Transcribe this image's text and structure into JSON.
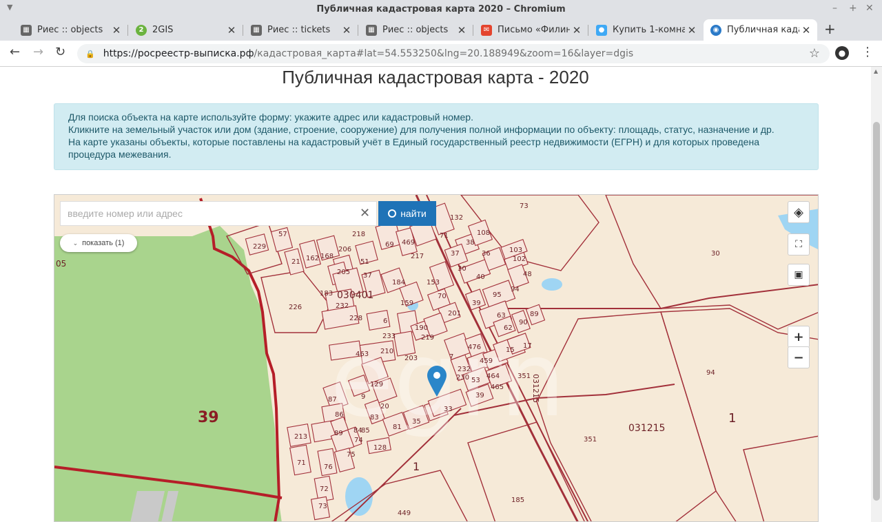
{
  "window": {
    "title": "Публичная кадастровая карта 2020 – Chromium"
  },
  "tabs": [
    {
      "label": "Риес :: objects",
      "icon": "riesgrid-icon",
      "color": "#555"
    },
    {
      "label": "2GIS",
      "icon": "2gis-icon",
      "color": "#6bb33f"
    },
    {
      "label": "Риес :: tickets",
      "icon": "riesgrid-icon",
      "color": "#555"
    },
    {
      "label": "Риес :: objects",
      "icon": "riesgrid-icon",
      "color": "#555"
    },
    {
      "label": "Письмо «Филина",
      "icon": "mail-icon",
      "color": "#e4442e"
    },
    {
      "label": "Купить 1-комнат",
      "icon": "avito-icon",
      "color": "#3fa9f5"
    },
    {
      "label": "Публичная кадас",
      "icon": "map-site-icon",
      "color": "#2a7ac8"
    }
  ],
  "toolbar": {
    "url_host": "https://росреестр-выписка.рф",
    "url_rest": "/кадастровая_карта#lat=54.553250&lng=20.188949&zoom=16&layer=dgis"
  },
  "page": {
    "title": "Публичная кадастровая карта - 2020",
    "info_lines": [
      "Для поиска объекта на карте используйте форму: укажите адрес или кадастровый номер.",
      "Кликните на земельный участок или дом (здание, строение, сооружение) для получения полной информации по объекту: площадь, статус, назначение и др.",
      "На карте указаны объекты, которые поставлены на кадастровый учёт в Единый государственный реестр недвижимости (ЕГРН) и для которых проведена",
      "процедура межевания."
    ]
  },
  "map": {
    "search_placeholder": "введите номер или адрес",
    "search_value": "",
    "find_label": "найти",
    "show_label": "показать (1)",
    "labels": {
      "region_39": "39",
      "quarter_030401": "030401",
      "quarter_031215": "031215",
      "quarter_031215_vertical": "031215",
      "edge_05": "05",
      "big_1": "1",
      "small_1": "1"
    },
    "parcels": [
      "73",
      "30",
      "94",
      "351",
      "351",
      "185",
      "449",
      "226",
      "229",
      "57",
      "21",
      "162",
      "168",
      "206",
      "218",
      "69",
      "469",
      "217",
      "71",
      "132",
      "108",
      "38",
      "37",
      "36",
      "30",
      "40",
      "103",
      "102",
      "48",
      "95",
      "94",
      "39",
      "63",
      "62",
      "90",
      "89",
      "205",
      "51",
      "37",
      "184",
      "153",
      "70",
      "201",
      "183",
      "232",
      "228",
      "159",
      "190",
      "219",
      "233",
      "210",
      "203",
      "463",
      "476",
      "459",
      "464",
      "465",
      "232",
      "230",
      "53",
      "39",
      "15",
      "17",
      "129",
      "33",
      "9",
      "20",
      "87",
      "86",
      "83",
      "81",
      "35",
      "213",
      "89",
      "84",
      "85",
      "74",
      "128",
      "71",
      "76",
      "75",
      "72",
      "73",
      "6",
      "7"
    ],
    "colors": {
      "parcel_line": "#a2303a",
      "boundary": "#b51e28",
      "forest": "#a9d48d",
      "water": "#9fd5f3",
      "marker": "#2b86c9",
      "background": "#f6ead8"
    }
  }
}
